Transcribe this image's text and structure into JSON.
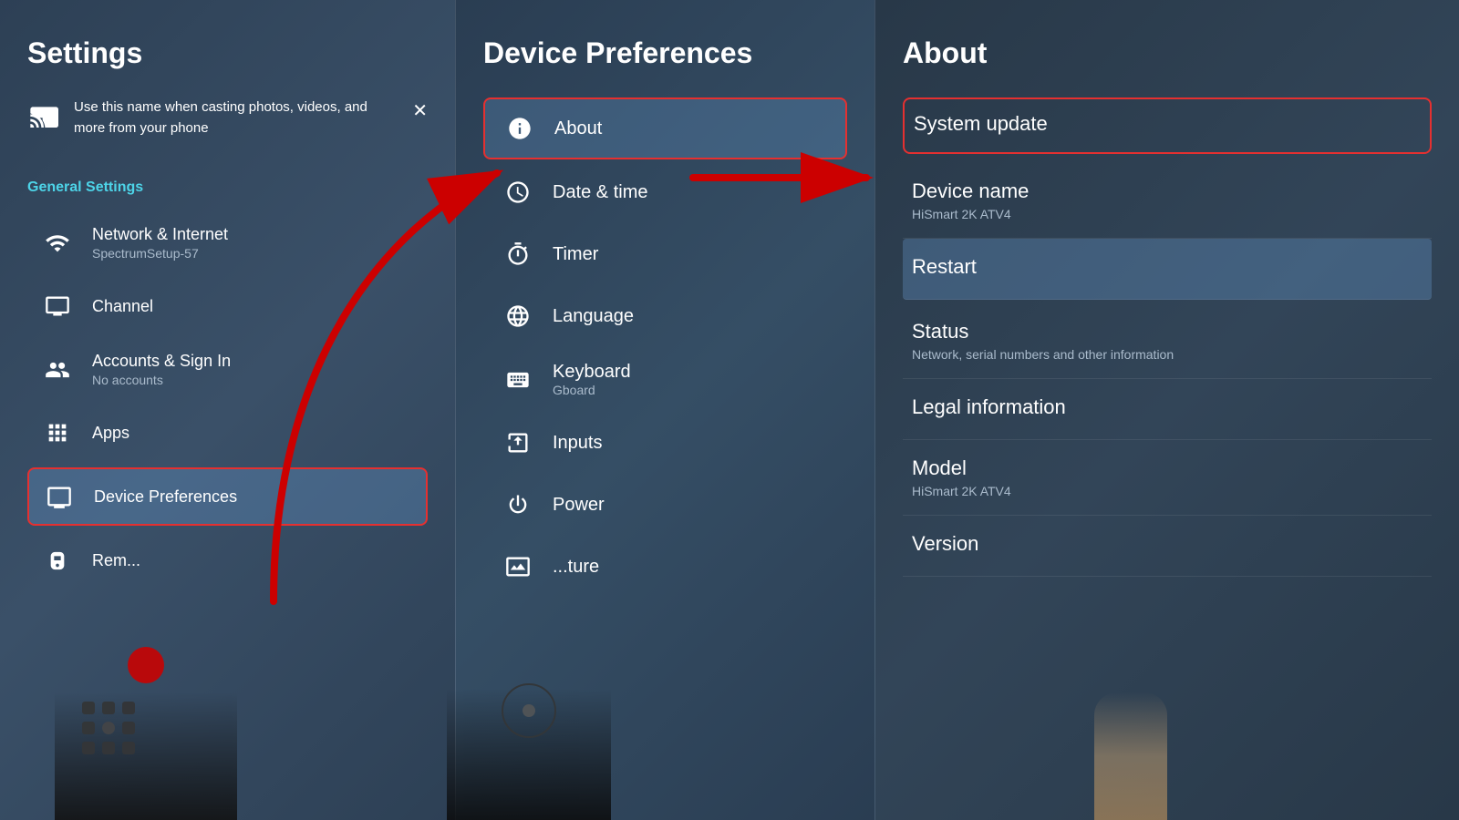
{
  "left": {
    "title": "Settings",
    "cast_hint": "Use this name when casting photos, videos, and more from your phone",
    "section_label": "General Settings",
    "items": [
      {
        "id": "network",
        "icon": "wifi",
        "title": "Network & Internet",
        "subtitle": "SpectrumSetup-57"
      },
      {
        "id": "channel",
        "icon": "tv",
        "title": "Channel",
        "subtitle": ""
      },
      {
        "id": "accounts",
        "icon": "accounts",
        "title": "Accounts & Sign In",
        "subtitle": "No accounts"
      },
      {
        "id": "apps",
        "icon": "apps",
        "title": "Apps",
        "subtitle": ""
      },
      {
        "id": "device-prefs",
        "icon": "monitor",
        "title": "Device Preferences",
        "subtitle": "",
        "active": true
      },
      {
        "id": "remote",
        "icon": "remote",
        "title": "Rem...",
        "subtitle": ""
      }
    ]
  },
  "middle": {
    "title": "Device Preferences",
    "items": [
      {
        "id": "about",
        "icon": "info",
        "title": "About",
        "subtitle": "",
        "active": true
      },
      {
        "id": "datetime",
        "icon": "clock",
        "title": "Date & time",
        "subtitle": ""
      },
      {
        "id": "timer",
        "icon": "timer",
        "title": "Timer",
        "subtitle": ""
      },
      {
        "id": "language",
        "icon": "language",
        "title": "Language",
        "subtitle": ""
      },
      {
        "id": "keyboard",
        "icon": "keyboard",
        "title": "Keyboard",
        "subtitle": "Gboard"
      },
      {
        "id": "inputs",
        "icon": "inputs",
        "title": "Inputs",
        "subtitle": ""
      },
      {
        "id": "power",
        "icon": "power",
        "title": "Power",
        "subtitle": ""
      },
      {
        "id": "picture",
        "icon": "picture",
        "title": "...ture",
        "subtitle": ""
      }
    ]
  },
  "right": {
    "title": "About",
    "items": [
      {
        "id": "system-update",
        "title": "System update",
        "subtitle": "",
        "highlighted": true
      },
      {
        "id": "device-name",
        "title": "Device name",
        "subtitle": "HiSmart 2K ATV4"
      },
      {
        "id": "restart",
        "title": "Restart",
        "subtitle": "",
        "active": true
      },
      {
        "id": "status",
        "title": "Status",
        "subtitle": "Network, serial numbers and other information"
      },
      {
        "id": "legal",
        "title": "Legal information",
        "subtitle": ""
      },
      {
        "id": "model",
        "title": "Model",
        "subtitle": "HiSmart 2K ATV4"
      },
      {
        "id": "version",
        "title": "Version",
        "subtitle": ""
      }
    ]
  }
}
